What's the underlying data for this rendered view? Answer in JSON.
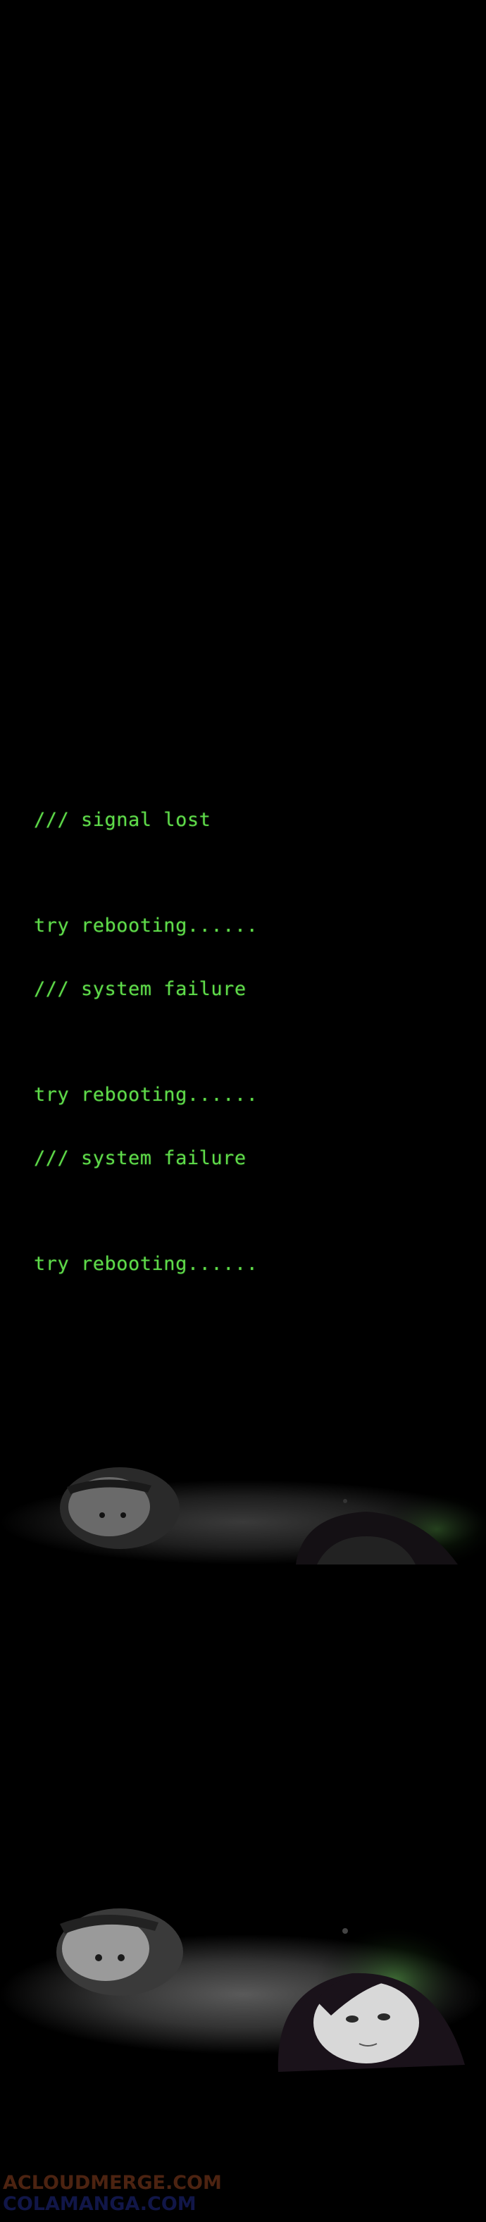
{
  "terminal": {
    "lines": [
      "/// signal lost",
      "try rebooting......",
      "/// system failure",
      "try rebooting......",
      "/// system failure",
      "try rebooting......"
    ],
    "text_color": "#5fdc4a"
  },
  "panels": [
    {
      "description_icon": "faces-dim-illustration"
    },
    {
      "description_icon": "faces-bright-illustration"
    }
  ],
  "watermark": {
    "line1": "ACLOUDMERGE.COM",
    "line2": "COLAMANGA.COM"
  }
}
